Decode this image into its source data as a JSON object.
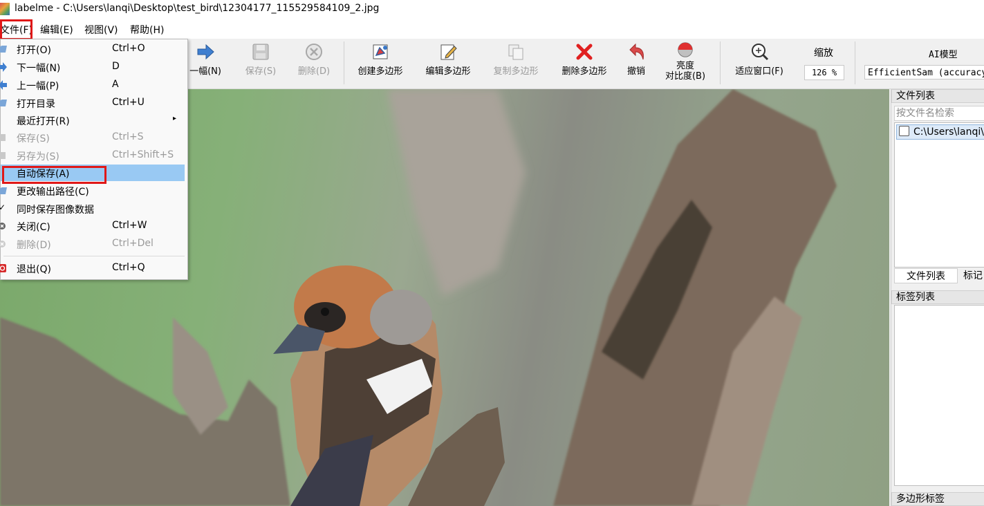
{
  "window": {
    "title": "labelme - C:\\Users\\lanqi\\Desktop\\test_bird\\12304177_115529584109_2.jpg"
  },
  "menubar": {
    "items": [
      "文件(F)",
      "编辑(E)",
      "视图(V)",
      "帮助(H)"
    ]
  },
  "toolbar": {
    "next_partial": "一幅(N)",
    "save": "保存(S)",
    "delete": "删除(D)",
    "create_polygon": "创建多边形",
    "edit_polygon": "编辑多边形",
    "copy_polygon": "复制多边形",
    "delete_polygon": "删除多边形",
    "undo": "撤销",
    "brightness_line1": "亮度",
    "brightness_line2": "对比度(B)",
    "fit_window": "适应窗口(F)",
    "zoom_label": "缩放",
    "zoom_value": "126 %",
    "ai_label": "AI模型",
    "ai_value": "EfficientSam (accuracy)"
  },
  "file_menu": {
    "items": [
      {
        "label": "打开(O)",
        "shortcut": "Ctrl+O"
      },
      {
        "label": "下一幅(N)",
        "shortcut": "D"
      },
      {
        "label": "上一幅(P)",
        "shortcut": "A"
      },
      {
        "label": "打开目录",
        "shortcut": "Ctrl+U"
      },
      {
        "label": "最近打开(R)",
        "shortcut": ""
      },
      {
        "label": "保存(S)",
        "shortcut": "Ctrl+S"
      },
      {
        "label": "另存为(S)",
        "shortcut": "Ctrl+Shift+S"
      },
      {
        "label": "自动保存(A)",
        "shortcut": ""
      },
      {
        "label": "更改输出路径(C)",
        "shortcut": ""
      },
      {
        "label": "同时保存图像数据",
        "shortcut": ""
      },
      {
        "label": "关闭(C)",
        "shortcut": "Ctrl+W"
      },
      {
        "label": "删除(D)",
        "shortcut": "Ctrl+Del"
      },
      {
        "label": "退出(Q)",
        "shortcut": "Ctrl+Q"
      }
    ]
  },
  "right_panel": {
    "file_list_title": "文件列表",
    "search_placeholder": "按文件名检索",
    "file_entry": "C:\\Users\\lanqi\\",
    "tab_files": "文件列表",
    "tab_labels": "标记",
    "label_list_title": "标签列表",
    "polygon_labels_title": "多边形标签"
  },
  "colors": {
    "highlight_box": "#e01818",
    "menu_active": "#99c9f3"
  }
}
